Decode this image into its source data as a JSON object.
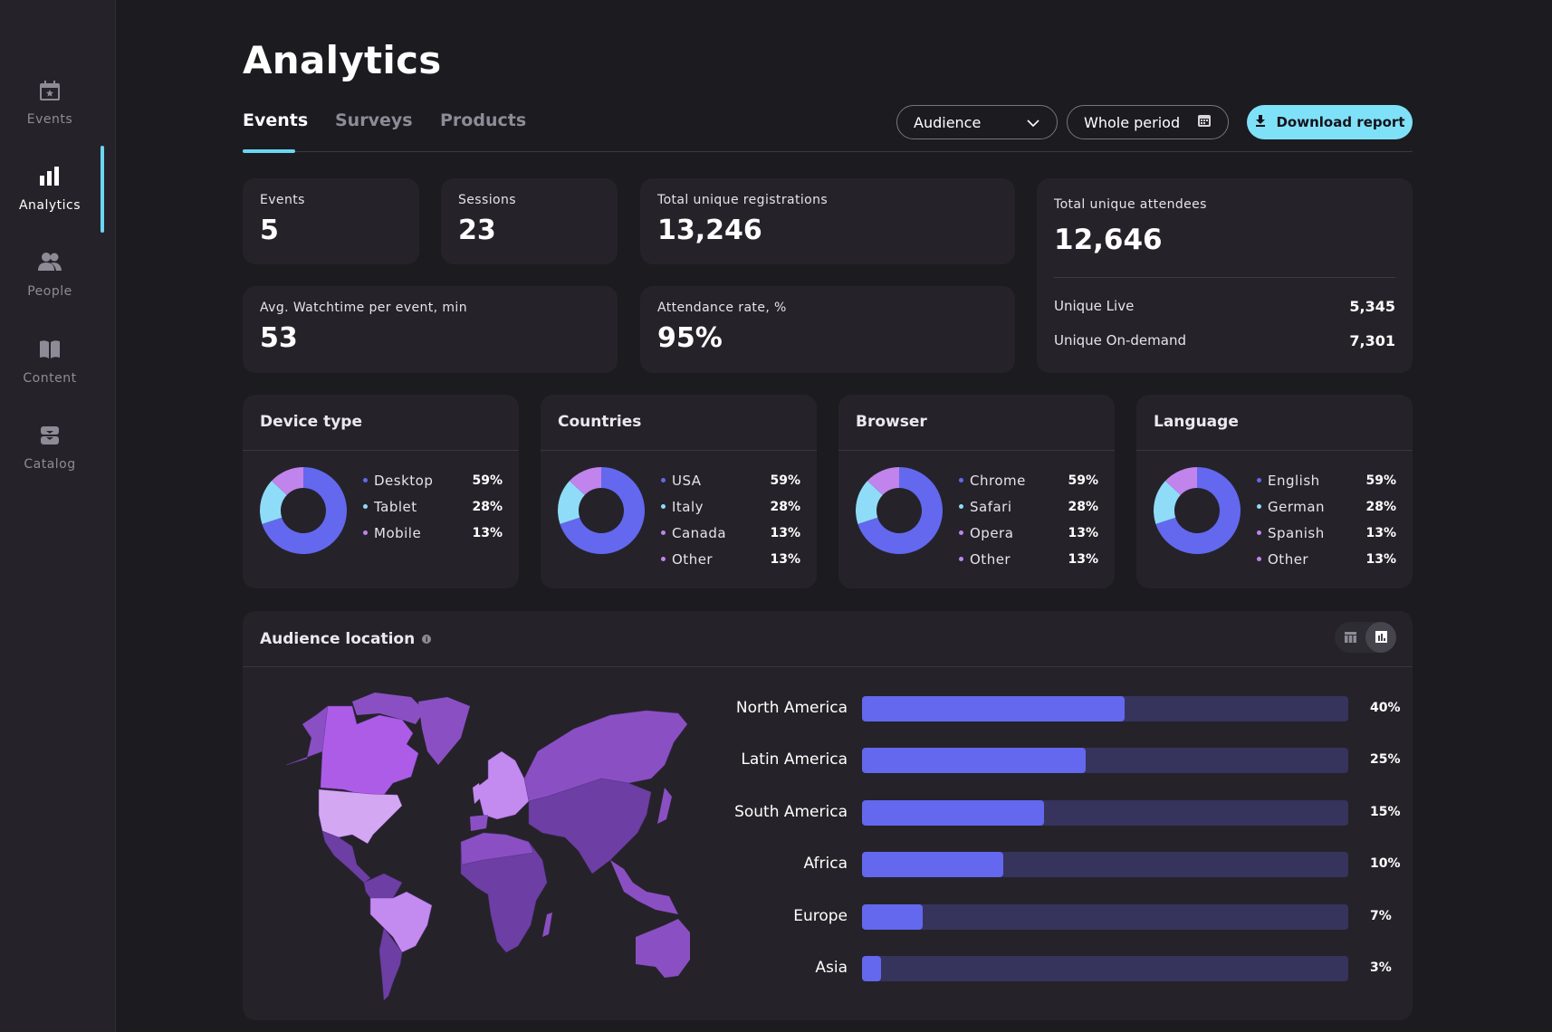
{
  "sidebar": {
    "items": [
      {
        "label": "Events",
        "icon": "calendar-star-icon",
        "active": false
      },
      {
        "label": "Analytics",
        "icon": "bar-chart-icon",
        "active": true
      },
      {
        "label": "People",
        "icon": "people-icon",
        "active": false
      },
      {
        "label": "Content",
        "icon": "book-icon",
        "active": false
      },
      {
        "label": "Catalog",
        "icon": "inbox-tray-icon",
        "active": false
      }
    ]
  },
  "header": {
    "title": "Analytics",
    "tabs": [
      {
        "label": "Events",
        "active": true
      },
      {
        "label": "Surveys",
        "active": false
      },
      {
        "label": "Products",
        "active": false
      }
    ],
    "audience_select": {
      "value": "Audience",
      "icon": "chevron-down-icon"
    },
    "period_select": {
      "value": "Whole period",
      "icon": "calendar-icon"
    },
    "download_button": {
      "label": "Download report",
      "icon": "download-icon"
    }
  },
  "kpis": {
    "events": {
      "label": "Events",
      "value": "5"
    },
    "sessions": {
      "label": "Sessions",
      "value": "23"
    },
    "registrations": {
      "label": "Total unique registrations",
      "value": "13,246"
    },
    "watchtime": {
      "label": "Avg. Watchtime per event, min",
      "value": "53"
    },
    "attendance": {
      "label": "Attendance rate, %",
      "value": "95%"
    },
    "attendees": {
      "label": "Total unique attendees",
      "value": "12,646",
      "breakdown": [
        {
          "label": "Unique Live",
          "value": "5,345"
        },
        {
          "label": "Unique On-demand",
          "value": "7,301"
        }
      ]
    }
  },
  "colors": {
    "accent": "#6ad6f3",
    "button": "#7fe1f8",
    "slice_primary": "#6368ef",
    "slice_secondary": "#8fdcf9",
    "slice_tertiary": "#c183ec",
    "bar_fill": "#6368ef",
    "bar_track": "#36345d"
  },
  "chart_data": [
    {
      "type": "pie",
      "title": "Device type",
      "categories": [
        "Desktop",
        "Tablet",
        "Mobile"
      ],
      "labels": [
        "59%",
        "28%",
        "13%"
      ],
      "slices": [
        0.7,
        0.17,
        0.13
      ],
      "legend_colors": [
        "#6368ef",
        "#8fdcf9",
        "#c183ec"
      ]
    },
    {
      "type": "pie",
      "title": "Countries",
      "categories": [
        "USA",
        "Italy",
        "Canada",
        "Other"
      ],
      "labels": [
        "59%",
        "28%",
        "13%",
        "13%"
      ],
      "slices": [
        0.7,
        0.17,
        0.13
      ],
      "legend_colors": [
        "#6368ef",
        "#8fdcf9",
        "#c183ec",
        "#c183ec"
      ]
    },
    {
      "type": "pie",
      "title": "Browser",
      "categories": [
        "Chrome",
        "Safari",
        "Opera",
        "Other"
      ],
      "labels": [
        "59%",
        "28%",
        "13%",
        "13%"
      ],
      "slices": [
        0.7,
        0.17,
        0.13
      ],
      "legend_colors": [
        "#6368ef",
        "#8fdcf9",
        "#c183ec",
        "#c183ec"
      ]
    },
    {
      "type": "pie",
      "title": "Language",
      "categories": [
        "English",
        "German",
        "Spanish",
        "Other"
      ],
      "labels": [
        "59%",
        "28%",
        "13%",
        "13%"
      ],
      "slices": [
        0.7,
        0.17,
        0.13
      ],
      "legend_colors": [
        "#6368ef",
        "#8fdcf9",
        "#c183ec",
        "#c183ec"
      ]
    },
    {
      "type": "bar",
      "orientation": "horizontal",
      "title": "Audience location",
      "categories": [
        "North America",
        "Latin America",
        "South America",
        "Africa",
        "Europe",
        "Asia"
      ],
      "labels": [
        "40%",
        "25%",
        "15%",
        "10%",
        "7%",
        "3%"
      ],
      "fill_fractions": [
        0.54,
        0.46,
        0.375,
        0.29,
        0.125,
        0.04
      ]
    }
  ],
  "audience_location": {
    "title": "Audience location",
    "info_icon": "info-icon",
    "view_toggle": [
      {
        "icon": "table-icon",
        "active": false
      },
      {
        "icon": "chart-icon",
        "active": true
      }
    ]
  }
}
